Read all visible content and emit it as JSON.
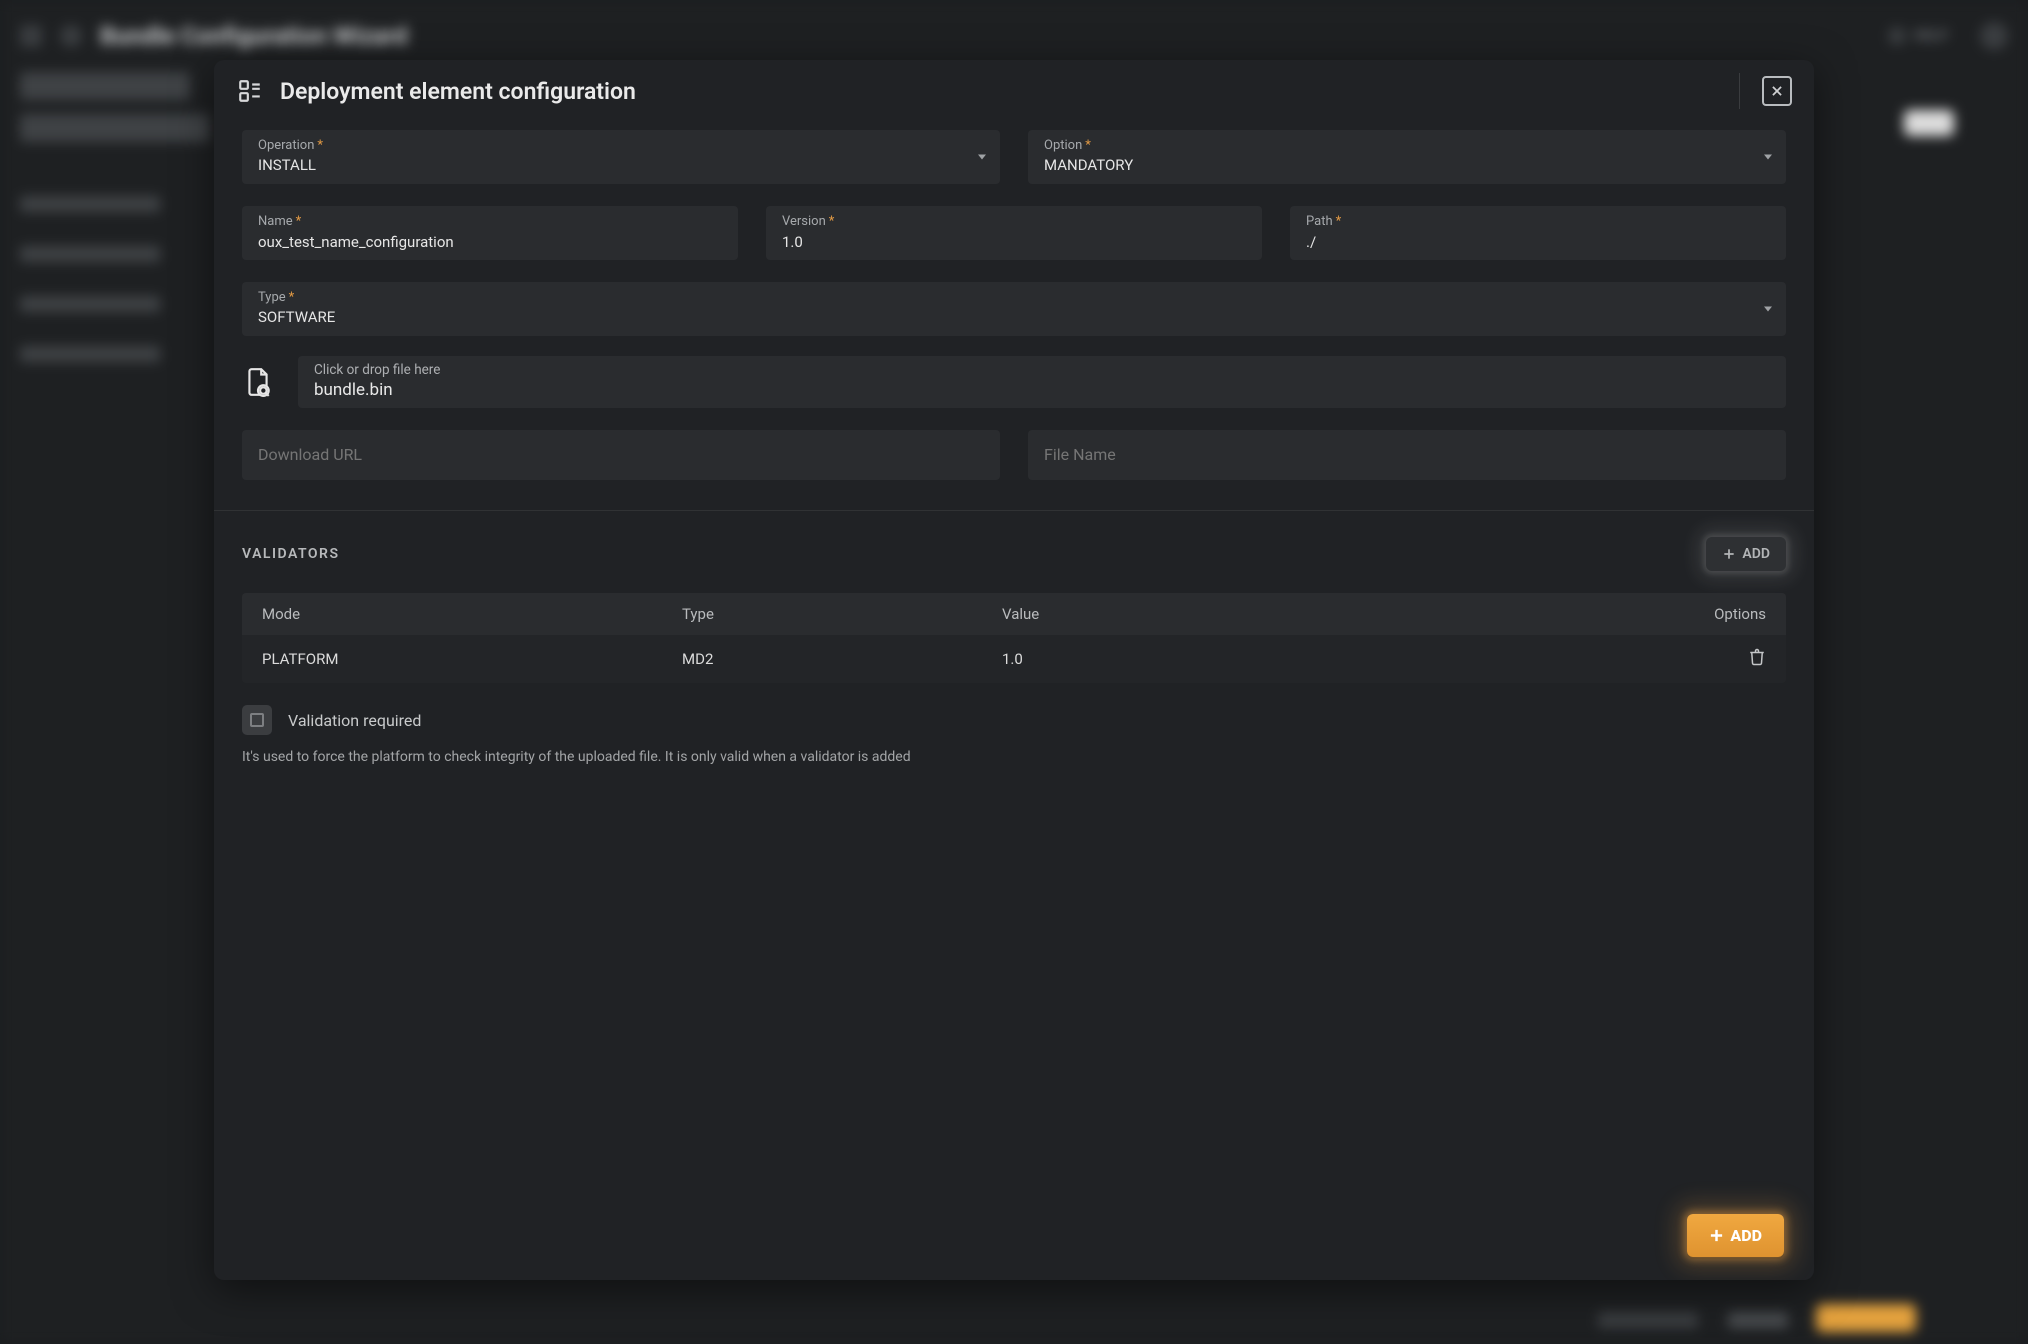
{
  "bg": {
    "page_title": "Bundle Configuration Wizard",
    "help": "HELP"
  },
  "modal": {
    "title": "Deployment element configuration",
    "fields": {
      "operation": {
        "label": "Operation",
        "value": "INSTALL"
      },
      "option": {
        "label": "Option",
        "value": "MANDATORY"
      },
      "name": {
        "label": "Name",
        "value": "oux_test_name_configuration"
      },
      "version": {
        "label": "Version",
        "value": "1.0"
      },
      "path": {
        "label": "Path",
        "value": "./"
      },
      "type": {
        "label": "Type",
        "value": "SOFTWARE"
      },
      "download_url": {
        "placeholder": "Download URL"
      },
      "file_name": {
        "placeholder": "File Name"
      }
    },
    "file": {
      "hint": "Click or drop file here",
      "name": "bundle.bin"
    },
    "validators": {
      "heading": "VALIDATORS",
      "add_label": "ADD",
      "columns": {
        "mode": "Mode",
        "type": "Type",
        "value": "Value",
        "options": "Options"
      },
      "rows": [
        {
          "mode": "PLATFORM",
          "type": "MD2",
          "value": "1.0"
        }
      ]
    },
    "validation_required": {
      "label": "Validation required",
      "checked": false,
      "hint": "It's used to force the platform to check integrity of the uploaded file. It is only valid when a validator is added"
    },
    "footer": {
      "add_label": "ADD"
    }
  }
}
